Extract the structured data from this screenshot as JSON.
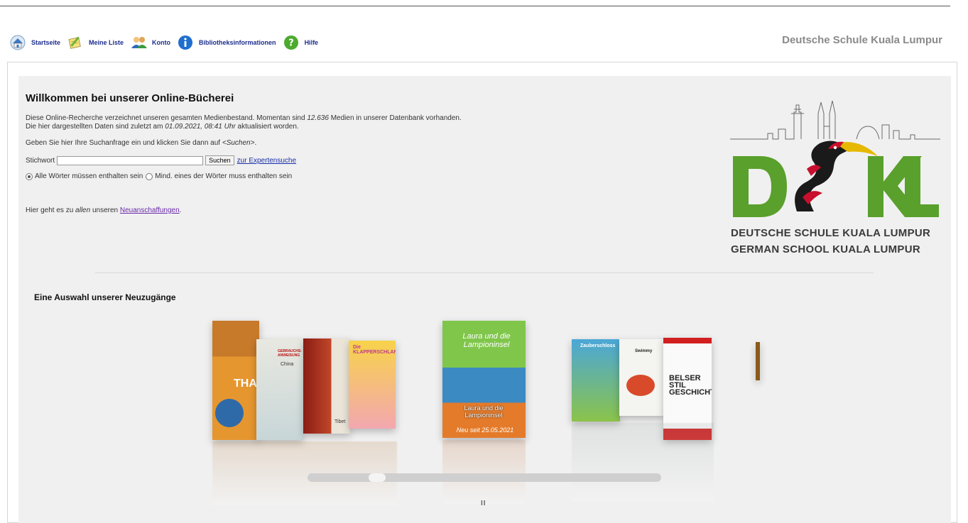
{
  "nav": {
    "items": [
      {
        "label": "Startseite",
        "icon": "home-icon"
      },
      {
        "label": "Meine Liste",
        "icon": "notepad-pencil-icon"
      },
      {
        "label": "Konto",
        "icon": "users-icon"
      },
      {
        "label": "Bibliotheksinformationen",
        "icon": "info-icon"
      },
      {
        "label": "Hilfe",
        "icon": "help-icon"
      }
    ],
    "site_title": "Deutsche Schule Kuala Lumpur"
  },
  "welcome": {
    "title": "Willkommen bei unserer Online-Bücherei",
    "line1_a": "Diese Online-Recherche verzeichnet unseren gesamten Medienbestand. Momentan sind ",
    "media_count": "12.636",
    "line1_b": " Medien in unserer Datenbank vorhanden.",
    "line2_a": "Die hier dargestellten Daten sind zuletzt am ",
    "updated": "01.09.2021, 08:41 Uhr",
    "line2_b": " aktualisiert worden.",
    "instructions_a": "Geben Sie hier Ihre Suchanfrage ein und klicken Sie dann auf ",
    "instructions_em": "<Suchen>",
    "instructions_b": ".",
    "search_label": "Stichwort",
    "search_value": "",
    "search_button": "Suchen",
    "expert_link": "zur Expertensuche",
    "radio_all": "Alle Wörter müssen enthalten sein",
    "radio_any": "Mind. eines der Wörter muss enthalten sein",
    "new_a": "Hier geht es zu ",
    "new_em": "allen",
    "new_b": " unseren ",
    "new_link": "Neuanschaffungen",
    "new_c": "."
  },
  "logo": {
    "letters": "DSKL",
    "line1": "DEUTSCHE SCHULE KUALA LUMPUR",
    "line2": "GERMAN SCHOOL KUALA LUMPUR",
    "green": "#5aa02c"
  },
  "carousel": {
    "title": "Eine Auswahl unserer Neuzugänge",
    "featured_title": "Laura und die Lampioninsel",
    "featured_caption": "Laura und die Lampioninsel",
    "featured_note": "Neu seit 25.05.2021",
    "cover_texts": [
      "THA",
      "GEBRAUCHS­ANWEISUNG",
      "China",
      "Tibet",
      "Die KLAPPERSCHLANGEN",
      "Zauberschloss",
      "Swimmy",
      "BELSER STIL GESCHICHTE"
    ],
    "pause": "II"
  }
}
